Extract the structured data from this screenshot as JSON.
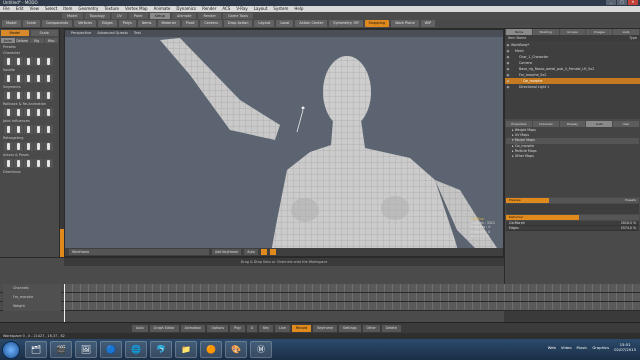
{
  "window": {
    "title": "Untitled* - MODO",
    "min": "_",
    "max": "□",
    "close": "✕"
  },
  "menu": [
    "File",
    "Edit",
    "View",
    "Select",
    "Item",
    "Geometry",
    "Texture",
    "Vertex Map",
    "Animate",
    "Dynamics",
    "Render",
    "ACS",
    "V-Ray",
    "Layout",
    "System",
    "Help"
  ],
  "layout_tabs": [
    {
      "label": "Model",
      "active": false
    },
    {
      "label": "Topology",
      "active": false
    },
    {
      "label": "UV",
      "active": false
    },
    {
      "label": "Paint",
      "active": false
    },
    {
      "label": "Setup",
      "active": true
    },
    {
      "label": "Animate",
      "active": false
    },
    {
      "label": "Render",
      "active": false
    },
    {
      "label": "Game Tools",
      "active": false
    }
  ],
  "toolbar": [
    "Model",
    "Scale",
    "Components",
    "Vertices",
    "Edges",
    "Polys",
    "Items",
    "Material",
    "Pivot",
    "Centers",
    "Drop Action",
    "Layout",
    "Local",
    "Action Center",
    "Symmetry: Off",
    "Snapping",
    "Work Plane",
    "WIP"
  ],
  "left": {
    "head": [
      "Model",
      "Scale"
    ],
    "tabs": [
      "Anim",
      "Deform",
      "Rig",
      "Misc"
    ],
    "sections": [
      "Presets",
      "Character",
      "Saddle",
      "Segments",
      "Rollback & Re-Animation",
      "Joint Influences",
      "Retargeting",
      "Actors & Poses",
      "Directions"
    ]
  },
  "viewport": {
    "tabs": [
      "Perspective",
      "Advanced Quests",
      "Text"
    ],
    "info": {
      "selected": "LifeBlue",
      "verts": "Vertices : 3321",
      "polys": "Polygons : 0",
      "channels": "Channels: 0",
      "gl": "GL: 14,376"
    },
    "foot": {
      "mode": "Wireframe",
      "item": "Add Keyframe",
      "mode2": "Auto",
      "status": "Drag & Drop Sons or Channels onto the Workspace"
    }
  },
  "scene": {
    "tabs": [
      "Items",
      "Shading",
      "Groups",
      "Images",
      "Lists"
    ],
    "header_left": "Item Name",
    "header_right": "Type",
    "items": [
      {
        "label": "WorkBody*",
        "sel": false,
        "indent": 0
      },
      {
        "label": "Mesh",
        "sel": false,
        "indent": 1
      },
      {
        "label": "Char_1_Character",
        "sel": false,
        "indent": 2
      },
      {
        "label": "Camera",
        "sel": false,
        "indent": 2
      },
      {
        "label": "Base_rig_Rosco_aerial_pub_4_Female_LH_Sx2",
        "sel": false,
        "indent": 2
      },
      {
        "label": "For_morphe_Sx2",
        "sel": false,
        "indent": 2
      },
      {
        "label": "Cw_morphe",
        "sel": true,
        "indent": 3
      },
      {
        "label": "Directional Light 1",
        "sel": false,
        "indent": 2
      }
    ]
  },
  "properties": {
    "tabs": [
      "Properties",
      "Channels",
      "Display",
      "Lists",
      "User"
    ],
    "rows": [
      {
        "label": "Weight Maps",
        "act": false
      },
      {
        "label": "UV Maps",
        "act": false
      },
      {
        "label": "Morph Maps",
        "act": true
      },
      {
        "label": "Cw_morphe",
        "act": false
      },
      {
        "label": "Particle Maps",
        "act": false
      },
      {
        "label": "Other Maps",
        "act": false
      }
    ],
    "morph_bar": {
      "left": "Preview",
      "right": "Presets",
      "fill": 0.32
    },
    "weight_bar": {
      "left": "Deformer",
      "right": "",
      "fill": 0.55
    },
    "list": [
      {
        "name": "Cw:Morph",
        "val": "2818.0 %"
      },
      {
        "name": "Edges",
        "val": "5574.0 %"
      }
    ]
  },
  "timeline": {
    "tracks": [
      "Channels",
      "For_morphe",
      "Weight"
    ],
    "start": "0",
    "end": "120"
  },
  "transport": [
    "Auto",
    "Graph Editor",
    "Animation",
    "Options",
    "Play",
    "Key",
    "Live",
    "Record",
    "Keyframe",
    "Settings",
    "Other",
    "Delete"
  ],
  "frame_value": "0",
  "status": "Workspace 0 , 0 - 21427 , 16,37 , 82",
  "taskbar": {
    "icons": [
      "🗂",
      "🎬",
      "🖼",
      "🔵",
      "🌐",
      "🐬",
      "📁",
      "🟠",
      "🎨",
      "Ⓜ"
    ],
    "tray": [
      "Web",
      "Video",
      "Music",
      "Graphics"
    ],
    "time": "15:51",
    "date": "02/07/2015"
  }
}
